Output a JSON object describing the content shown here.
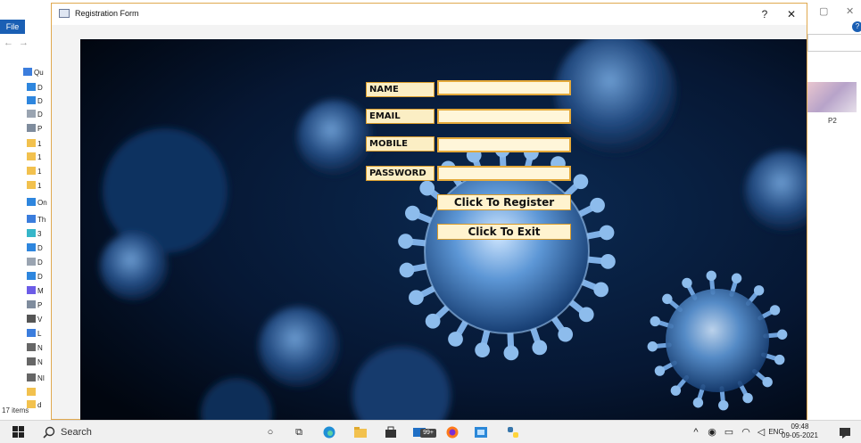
{
  "explorer": {
    "file_tab": "File",
    "status_items": "17 items",
    "thumbnail_label": "P2",
    "help_glyph": "?",
    "sidebar": [
      {
        "label": "Qu",
        "color": "#3b7ddd"
      },
      {
        "label": "D",
        "color": "#2e86de"
      },
      {
        "label": "D",
        "color": "#2e86de"
      },
      {
        "label": "D",
        "color": "#9aa4b1"
      },
      {
        "label": "P",
        "color": "#7f8c9d"
      },
      {
        "label": "1",
        "color": "#f2c14e"
      },
      {
        "label": "1",
        "color": "#f2c14e"
      },
      {
        "label": "1",
        "color": "#f2c14e"
      },
      {
        "label": "1",
        "color": "#f2c14e"
      },
      {
        "label": "On",
        "color": "#2e86de"
      },
      {
        "label": "Th",
        "color": "#3b7ddd"
      },
      {
        "label": "3",
        "color": "#36b6c9"
      },
      {
        "label": "D",
        "color": "#2e86de"
      },
      {
        "label": "D",
        "color": "#9aa4b1"
      },
      {
        "label": "D",
        "color": "#2e86de"
      },
      {
        "label": "M",
        "color": "#6c5ce7"
      },
      {
        "label": "P",
        "color": "#7f8c9d"
      },
      {
        "label": "V",
        "color": "#555555"
      },
      {
        "label": "L",
        "color": "#3b7ddd"
      },
      {
        "label": "N",
        "color": "#666666"
      },
      {
        "label": "N",
        "color": "#666666"
      },
      {
        "label": "NI",
        "color": "#666666"
      },
      {
        "label": "",
        "color": "#f2c14e"
      },
      {
        "label": "d",
        "color": "#f2c14e"
      }
    ]
  },
  "dialog": {
    "title": "Registration Form",
    "help_glyph": "?",
    "close_glyph": "✕"
  },
  "form": {
    "name_label": "NAME",
    "email_label": "EMAIL",
    "mobile_label": "MOBILE",
    "password_label": "PASSWORD",
    "name_value": "",
    "email_value": "",
    "mobile_value": "",
    "password_value": "",
    "register_button": "Click To Register",
    "exit_button": "Click To Exit",
    "label_bg": "#fbeec4",
    "border_color": "#d89b2a"
  },
  "taskbar": {
    "search_label": "Search",
    "mail_badge": "99+",
    "language": "ENG",
    "time": "09:48",
    "date": "09-05-2021"
  }
}
